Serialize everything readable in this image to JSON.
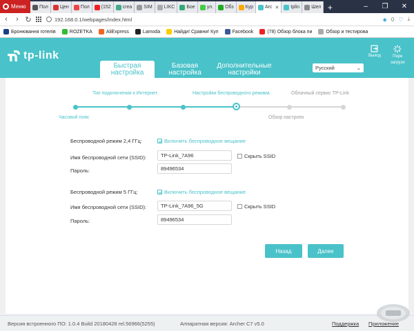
{
  "browser": {
    "menu_label": "Меню",
    "tabs": [
      {
        "label": "Пол",
        "color": "#555"
      },
      {
        "label": "Цен",
        "color": "#d33"
      },
      {
        "label": "Пол",
        "color": "#e44"
      },
      {
        "label": "(152",
        "color": "#e22"
      },
      {
        "label": "crea",
        "color": "#4a8"
      },
      {
        "label": "SIM",
        "color": "#999"
      },
      {
        "label": "LIKC",
        "color": "#aaa"
      },
      {
        "label": "Бое",
        "color": "#3a7"
      },
      {
        "label": "ул.",
        "color": "#4c4"
      },
      {
        "label": "Обз",
        "color": "#2a2"
      },
      {
        "label": "Кур",
        "color": "#fa0"
      },
      {
        "label": "Arc",
        "color": "#49c2c9",
        "active": true
      },
      {
        "label": "tplin",
        "color": "#49c2c9"
      },
      {
        "label": "Шел",
        "color": "#888"
      }
    ],
    "newtab_label": "+",
    "url": "192.168.0.1/webpages/index.html",
    "addr_count": "0",
    "bookmarks": [
      {
        "label": "Бронювання готелів",
        "color": "#1a3f88"
      },
      {
        "label": "ROZETKA",
        "color": "#3b3"
      },
      {
        "label": "AliExpress",
        "color": "#e62"
      },
      {
        "label": "Lamoda",
        "color": "#222"
      },
      {
        "label": "Найди! Сравни! Куп",
        "color": "#fc0"
      },
      {
        "label": "Facebook",
        "color": "#3b5998"
      },
      {
        "label": "(78) Обзор блока пи",
        "color": "#e22"
      },
      {
        "label": "Обзор и тестирова",
        "color": "#aaa"
      }
    ]
  },
  "header": {
    "logo_text": "tp-link",
    "nav_tabs": [
      {
        "line1": "Быстрая",
        "line2": "настройка",
        "active": true
      },
      {
        "line1": "Базовая",
        "line2": "настройка",
        "active": false
      },
      {
        "line1": "Дополнительные",
        "line2": "настройки",
        "active": false
      }
    ],
    "language": "Русский",
    "logout_label": "Выход",
    "reboot_label_1": "Пере",
    "reboot_label_2": "загрузи"
  },
  "wizard": {
    "steps_top": [
      "Тип подключения к Интернет",
      "Настройки беспроводного режима",
      "Облачный сервис TP-Link"
    ],
    "steps_bottom": [
      "Часовой пояс",
      "Обзор настроек"
    ]
  },
  "wireless_24": {
    "mode_label": "Беспроводной режим 2,4 ГГц:",
    "enable_label": "Включить беспроводное вещание",
    "enabled": true,
    "ssid_label": "Имя беспроводной сети (SSID):",
    "ssid_value": "TP-Link_7A96",
    "hide_ssid_label": "Скрыть SSID",
    "password_label": "Пароль:",
    "password_value": "89496534"
  },
  "wireless_5": {
    "mode_label": "Беспроводной режим 5 ГГц:",
    "enable_label": "Включить беспроводное вещание",
    "enabled": true,
    "ssid_label": "Имя беспроводной сети (SSID):",
    "ssid_value": "TP-Link_7A96_5G",
    "hide_ssid_label": "Скрыть SSID",
    "password_label": "Пароль:",
    "password_value": "89496534"
  },
  "buttons": {
    "back": "Назад",
    "next": "Далее"
  },
  "footer": {
    "firmware": "Версия встроенного ПО: 1.0.4 Build 20180428 rel.56966(5255)",
    "hardware": "Аппаратная версия: Archer C7 v5.0",
    "support": "Поддержка",
    "app": "Приложение"
  },
  "colors": {
    "accent": "#49c2c9"
  }
}
